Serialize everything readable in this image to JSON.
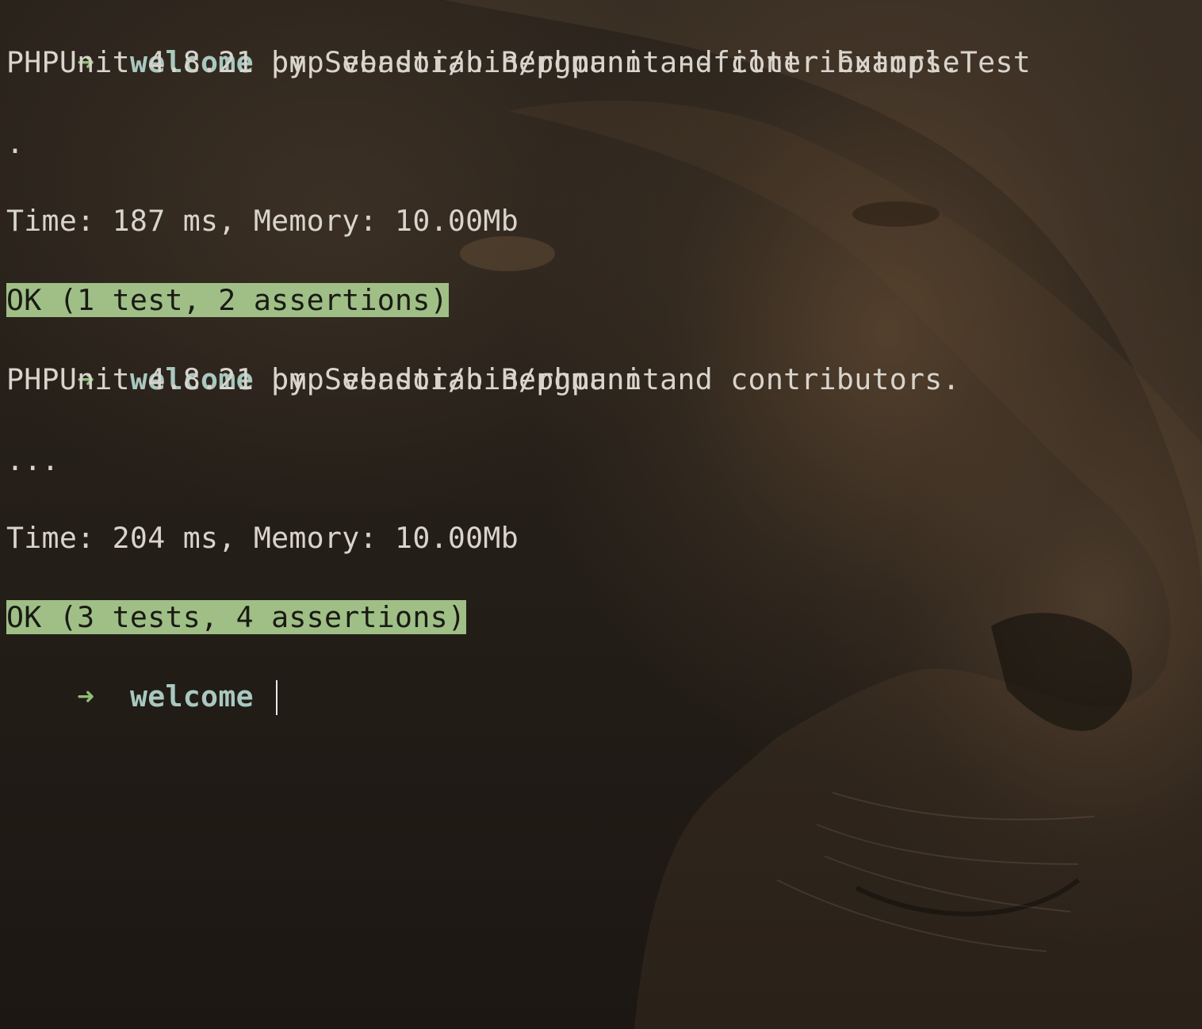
{
  "terminal": {
    "prompt_symbol": "➜",
    "cwd": "welcome",
    "lines": {
      "cmd1": "pmp vendor/bin/phpunit --filter ExampleTest",
      "header1": "PHPUnit 4.8.21 by Sebastian Bergmann and contributors.",
      "progress1": ".",
      "time1": "Time: 187 ms, Memory: 10.00Mb",
      "result1": "OK (1 test, 2 assertions)",
      "cmd2": "pmp vendor/bin/phpunit",
      "header2": "PHPUnit 4.8.21 by Sebastian Bergmann and contributors.",
      "progress2": "...",
      "time2": "Time: 204 ms, Memory: 10.00Mb",
      "result2": "OK (3 tests, 4 assertions)",
      "cmd3": ""
    }
  },
  "colors": {
    "prompt_arrow": "#8fbf78",
    "cwd": "#a8c8c0",
    "text": "#d9d4cc",
    "ok_background": "#9fbf86",
    "ok_text": "#1a1a14"
  }
}
